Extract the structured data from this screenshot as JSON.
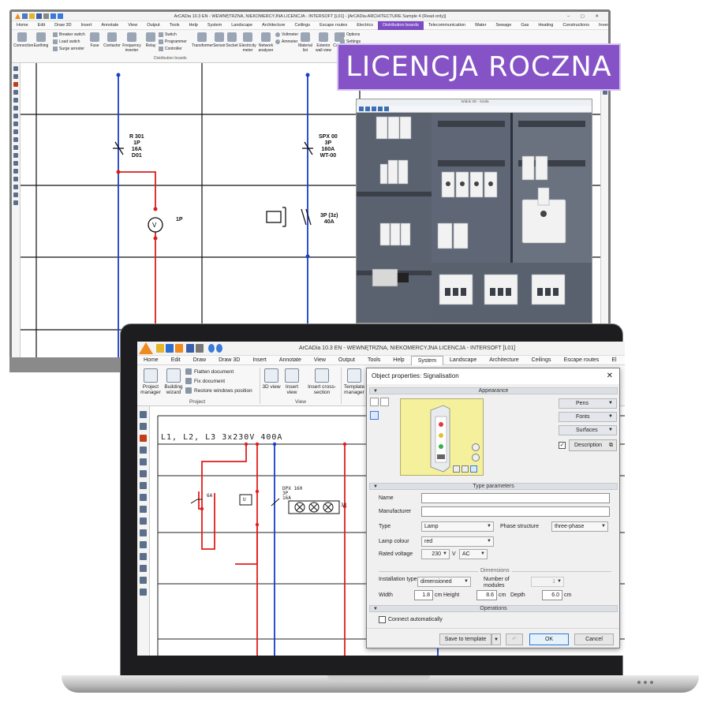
{
  "banner": {
    "text": "LICENCJA ROCZNA"
  },
  "monitor": {
    "title": "ArCADia 10.3 EN - WEWNĘTRZNA, NIEKOMERCYJNA LICENCJA - INTERSOFT [L01] - [ArCADia-ARCHITECTURE Sample 4 (Read-only)]",
    "menu": [
      "Home",
      "Edit",
      "Draw 3D",
      "Insert",
      "Annotate",
      "View",
      "Output",
      "Tools",
      "Help",
      "System",
      "Landscape",
      "Architecture",
      "Ceilings",
      "Escape routes",
      "Electrics",
      "Distribution boards",
      "Telecommunication",
      "Water",
      "Sewage",
      "Gas",
      "Heating",
      "Constructions",
      "Inventory control"
    ],
    "ribbon": {
      "connection": "Connection",
      "earthing": "Earthing",
      "breaker_switch": "Breaker switch",
      "load_switch": "Load switch",
      "surge_arrester": "Surge arrester",
      "fuse": "Fuse",
      "contactor": "Contactor",
      "frequency_inverter": "Frequency inverter",
      "relay": "Relay",
      "switch": "Switch",
      "programmer": "Programmer",
      "controller": "Controller",
      "transformer": "Transformer",
      "sensor": "Sensor",
      "socket": "Socket",
      "electricity_meter": "Electricity meter",
      "network_analyser": "Network analyser",
      "voltmeter": "Voltmeter",
      "ammeter": "Ammeter",
      "material_list": "Material list",
      "exterior_wall_view": "Exterior wall view",
      "casing": "Casing",
      "options": "Options",
      "settings": "Settings",
      "group_label": "Distribution boards"
    },
    "schematic": {
      "r301": [
        "R 301",
        "1P",
        "16A",
        "D01"
      ],
      "voltmeter_label": "1P",
      "spx": [
        "SPX 00",
        "3P",
        "160A",
        "WT-00"
      ],
      "contactor": [
        "3P (3z)",
        "40A"
      ]
    },
    "view3d_title": "Widok 3D - Szafa"
  },
  "app": {
    "title": "ArCADia 10.3 EN - WEWNĘTRZNA, NIEKOMERCYJNA LICENCJA - INTERSOFT [L01]",
    "menu": [
      "Home",
      "Edit",
      "Draw",
      "Draw 3D",
      "Insert",
      "Annotate",
      "View",
      "Output",
      "Tools",
      "Help",
      "System",
      "Landscape",
      "Architecture",
      "Ceilings",
      "Escape routes",
      "El"
    ],
    "active_tab": "System",
    "ribbon": {
      "project_manager": "Project manager",
      "building_wizard": "Building wizard",
      "flatten_document": "Flatten document",
      "fix_document": "Fix document",
      "restore_windows_position": "Restore windows position",
      "group_project": "Project",
      "view_3d": "3D view",
      "insert_view": "Insert view",
      "insert_cross_section": "Insert cross-section",
      "group_view": "View",
      "template_manager": "Template manager"
    },
    "canvas": {
      "bus_label": "L1, L2, L3 3x230V 400A",
      "breaker_label": "6A",
      "dpx_label": [
        "DPX 160",
        "3P",
        "16A"
      ],
      "u_label": "U",
      "lamp_label": "3P"
    }
  },
  "dialog": {
    "title": "Object properties: Signalisation",
    "close": "✕",
    "sections": {
      "appearance": "Appearance",
      "type_parameters": "Type parameters",
      "dimensions": "Dimensions",
      "operations": "Operations"
    },
    "buttons_right": {
      "pens": "Pens",
      "fonts": "Fonts",
      "surfaces": "Surfaces",
      "description": "Description"
    },
    "description_checked": true,
    "fields": {
      "name_label": "Name",
      "name_value": "",
      "manufacturer_label": "Manufacturer",
      "manufacturer_value": "",
      "type_label": "Type",
      "type_value": "Lamp",
      "phase_label": "Phase structure",
      "phase_value": "three-phase",
      "colour_label": "Lamp colour",
      "colour_value": "red",
      "voltage_label": "Rated voltage",
      "voltage_value": "230",
      "voltage_unit": "V",
      "voltage_kind": "AC",
      "installation_label": "Installation type",
      "installation_value": "dimensioned",
      "modules_label": "Number of modules",
      "modules_value": "1",
      "width_label": "Width",
      "width_value": "1.8",
      "width_unit": "cm",
      "height_label": "Height",
      "height_value": "8.6",
      "height_unit": "cm",
      "depth_label": "Depth",
      "depth_value": "6.0",
      "depth_unit": "cm"
    },
    "connect_label": "Connect automatically",
    "connect_checked": false,
    "footer": {
      "save_template": "Save to template",
      "ok": "OK",
      "cancel": "Cancel"
    }
  }
}
